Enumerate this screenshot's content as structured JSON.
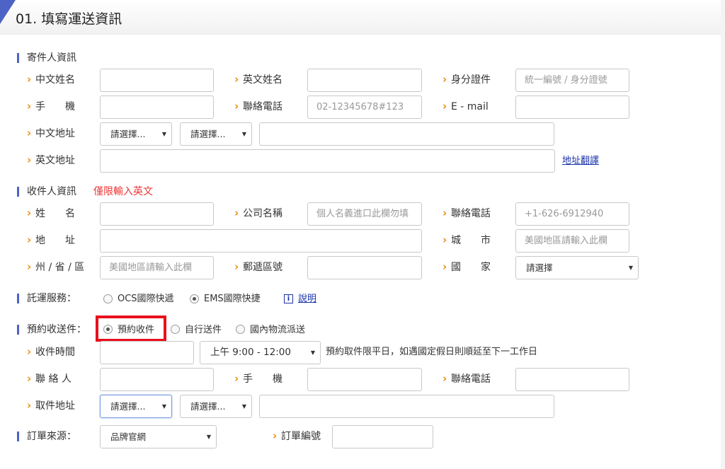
{
  "header": {
    "title": "01. 填寫運送資訊"
  },
  "sender": {
    "section": "寄件人資訊",
    "chinese_name_label": "中文姓名",
    "english_name_label": "英文姓名",
    "id_label": "身分證件",
    "id_placeholder": "統一編號 / 身分證號",
    "mobile_label": "手　　機",
    "phone_label": "聯絡電話",
    "phone_placeholder": "02-12345678#123",
    "email_label": "E - mail",
    "cn_address_label": "中文地址",
    "select_a": "請選擇...",
    "select_b": "請選擇...",
    "en_address_label": "英文地址",
    "translate_link": "地址翻譯"
  },
  "recipient": {
    "section": "收件人資訊",
    "english_only_note": "僅限輸入英文",
    "name_label": "姓　　名",
    "company_label": "公司名稱",
    "company_placeholder": "個人名義進口此欄勿填",
    "phone_label": "聯絡電話",
    "phone_placeholder": "+1-626-6912940",
    "address_label": "地　　址",
    "city_label": "城　　市",
    "city_placeholder": "美國地區請輸入此欄",
    "state_label": "州 / 省 / 區",
    "state_placeholder": "美國地區請輸入此欄",
    "zip_label": "郵遞區號",
    "country_label": "國　　家",
    "country_select": "請選擇"
  },
  "service": {
    "label": "託運服務：",
    "options": [
      "OCS國際快遞",
      "EMS國際快捷"
    ],
    "selected": 1,
    "info_icon": "i",
    "info_link": "說明"
  },
  "pickup": {
    "label": "預約收送件：",
    "options": [
      "預約收件",
      "自行送件",
      "國內物流派送"
    ],
    "selected": 0,
    "time_label": "收件時間",
    "time_select": "上午 9:00 - 12:00",
    "time_note": "預約取件限平日，如遇國定假日則順延至下一工作日",
    "contact_label": "聯 絡 人",
    "mobile_label": "手　　機",
    "phone_label": "聯絡電話",
    "address_label": "取件地址",
    "select_a": "請選擇...",
    "select_b": "請選擇..."
  },
  "order": {
    "source_label": "訂單來源：",
    "source_select": "品牌官網",
    "number_label": "訂單編號"
  },
  "colors": {
    "accent": "#4d63c6",
    "arrow": "#f08c00",
    "link": "#1a33a8",
    "highlight": "#e8101c",
    "note": "#e33333"
  }
}
